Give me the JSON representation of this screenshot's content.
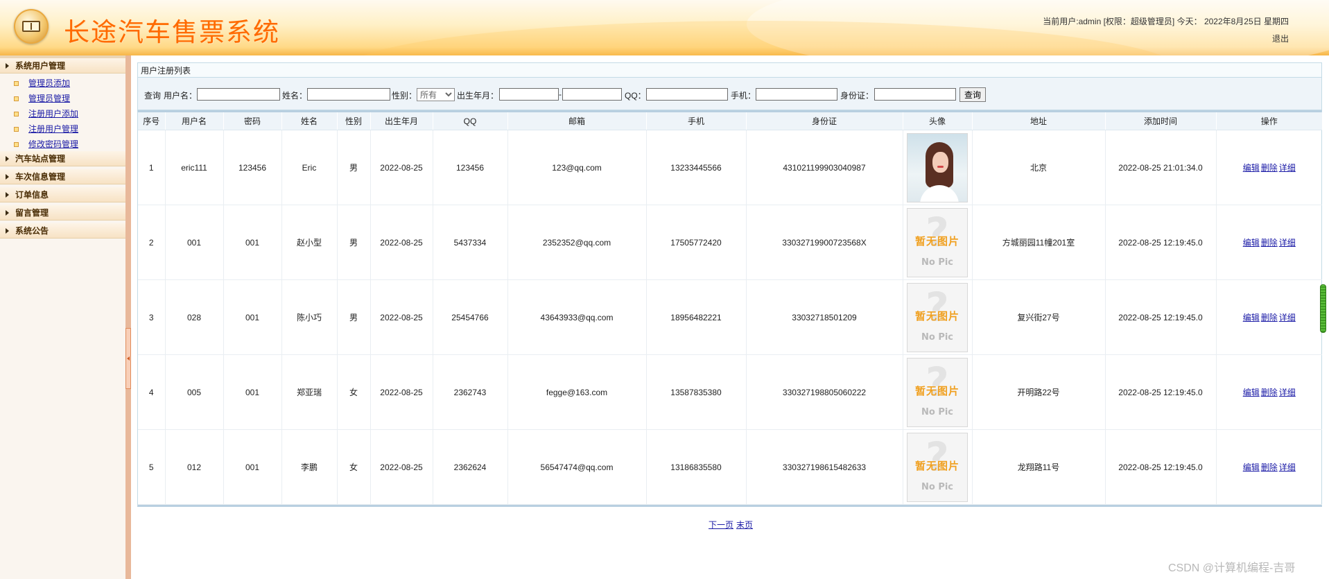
{
  "header": {
    "title": "长途汽车售票系统",
    "user_info": "当前用户:admin [权限：超级管理员] 今天： 2022年8月25日 星期四",
    "logout": "退出"
  },
  "sidebar": {
    "groups": [
      {
        "label": "系统用户管理",
        "items": [
          "管理员添加",
          "管理员管理",
          "注册用户添加",
          "注册用户管理",
          "修改密码管理"
        ]
      },
      {
        "label": "汽车站点管理"
      },
      {
        "label": "车次信息管理"
      },
      {
        "label": "订单信息"
      },
      {
        "label": "留言管理"
      },
      {
        "label": "系统公告"
      }
    ]
  },
  "list": {
    "caption": "用户注册列表"
  },
  "search": {
    "query_label": "查询",
    "username_label": "用户名：",
    "name_label": "姓名：",
    "gender_label": "性别：",
    "gender_selected": "所有",
    "birth_label": "出生年月：",
    "range_sep": "-",
    "qq_label": "QQ：",
    "phone_label": "手机：",
    "idcard_label": "身份证：",
    "button": "查询"
  },
  "table": {
    "headers": [
      "序号",
      "用户名",
      "密码",
      "姓名",
      "性别",
      "出生年月",
      "QQ",
      "邮箱",
      "手机",
      "身份证",
      "头像",
      "地址",
      "添加时间",
      "操作"
    ],
    "no_pic_zh": "暂无图片",
    "no_pic_en": "No Pic",
    "rows": [
      {
        "seq": "1",
        "username": "eric111",
        "password": "123456",
        "name": "Eric",
        "gender": "男",
        "birth": "2022-08-25",
        "qq": "123456",
        "email": "123@qq.com",
        "phone": "13233445566",
        "idcard": "431021199903040987",
        "address": "北京",
        "added": "2022-08-25 21:01:34.0"
      },
      {
        "seq": "2",
        "username": "001",
        "password": "001",
        "name": "赵小型",
        "gender": "男",
        "birth": "2022-08-25",
        "qq": "5437334",
        "email": "2352352@qq.com",
        "phone": "17505772420",
        "idcard": "33032719900723568X",
        "address": "方城丽园11幢201室",
        "added": "2022-08-25 12:19:45.0"
      },
      {
        "seq": "3",
        "username": "028",
        "password": "001",
        "name": "陈小巧",
        "gender": "男",
        "birth": "2022-08-25",
        "qq": "25454766",
        "email": "43643933@qq.com",
        "phone": "18956482221",
        "idcard": "33032718501209",
        "address": "复兴街27号",
        "added": "2022-08-25 12:19:45.0"
      },
      {
        "seq": "4",
        "username": "005",
        "password": "001",
        "name": "郑亚瑞",
        "gender": "女",
        "birth": "2022-08-25",
        "qq": "2362743",
        "email": "fegge@163.com",
        "phone": "13587835380",
        "idcard": "330327198805060222",
        "address": "开明路22号",
        "added": "2022-08-25 12:19:45.0"
      },
      {
        "seq": "5",
        "username": "012",
        "password": "001",
        "name": "李鹏",
        "gender": "女",
        "birth": "2022-08-25",
        "qq": "2362624",
        "email": "56547474@qq.com",
        "phone": "13186835580",
        "idcard": "330327198615482633",
        "address": "龙翔路11号",
        "added": "2022-08-25 12:19:45.0"
      }
    ],
    "actions": {
      "edit": "编辑",
      "delete": "删除",
      "detail": "详细"
    }
  },
  "pager": {
    "next": "下一页",
    "last": "末页"
  },
  "watermark": "CSDN @计算机编程-吉哥",
  "colors": {
    "title": "#ff6a00",
    "link": "#1a1aa6",
    "header_gold": "#f7b548"
  }
}
